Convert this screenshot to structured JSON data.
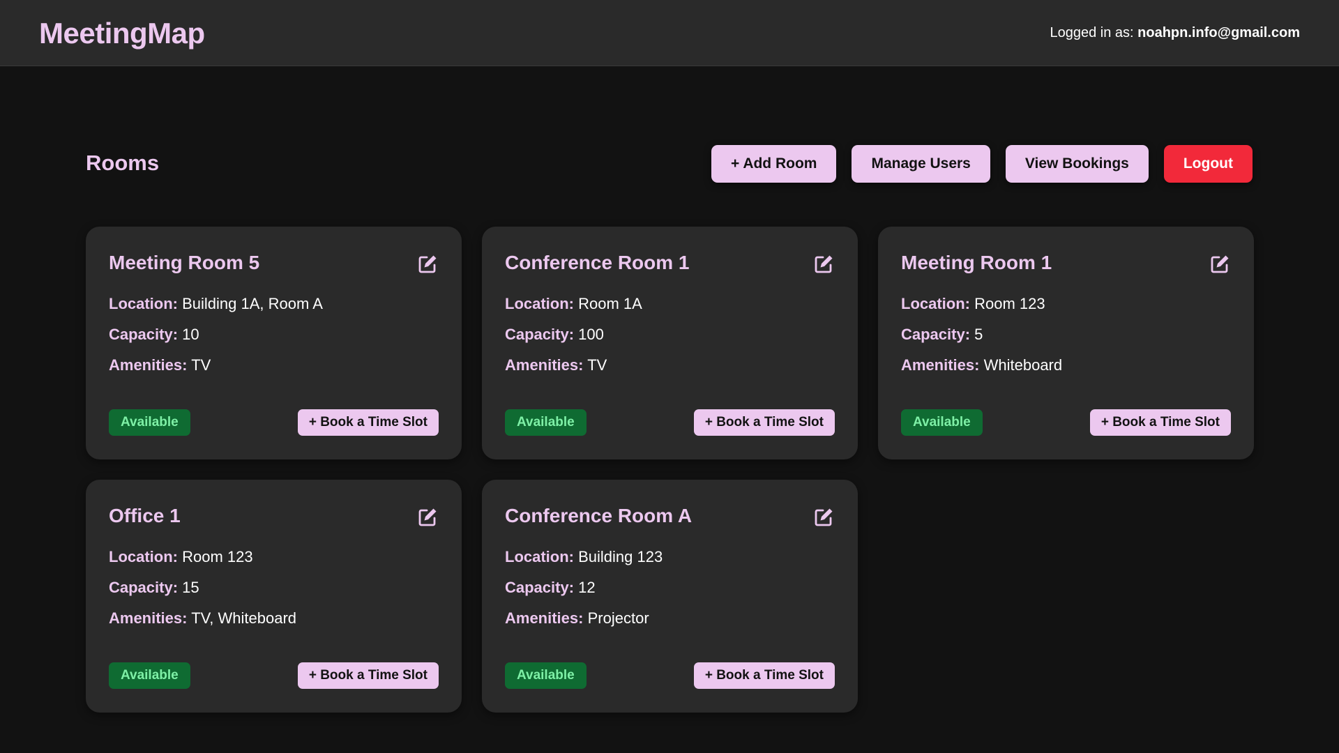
{
  "app": {
    "brand": "MeetingMap",
    "user_prefix": "Logged in as:",
    "user_email": "noahpn.info@gmail.com"
  },
  "colors": {
    "accent": "#ecc8ef",
    "background": "#121212",
    "card": "#2a2a2a",
    "danger": "#f2293a",
    "available_bg": "#0f6b32",
    "available_text": "#7ef0a6"
  },
  "page": {
    "title": "Rooms",
    "actions": {
      "add_room": "+ Add Room",
      "manage_users": "Manage Users",
      "view_bookings": "View Bookings",
      "logout": "Logout"
    }
  },
  "labels": {
    "location": "Location:",
    "capacity": "Capacity:",
    "amenities": "Amenities:",
    "book": "+ Book a Time Slot",
    "edit_icon": "edit-icon"
  },
  "rooms": [
    {
      "name": "Meeting Room 5",
      "location": "Building 1A, Room A",
      "capacity": "10",
      "amenities": "TV",
      "status": "Available"
    },
    {
      "name": "Conference Room 1",
      "location": "Room 1A",
      "capacity": "100",
      "amenities": "TV",
      "status": "Available"
    },
    {
      "name": "Meeting Room 1",
      "location": "Room 123",
      "capacity": "5",
      "amenities": "Whiteboard",
      "status": "Available"
    },
    {
      "name": "Office 1",
      "location": "Room 123",
      "capacity": "15",
      "amenities": "TV, Whiteboard",
      "status": "Available"
    },
    {
      "name": "Conference Room A",
      "location": "Building 123",
      "capacity": "12",
      "amenities": "Projector",
      "status": "Available"
    }
  ]
}
